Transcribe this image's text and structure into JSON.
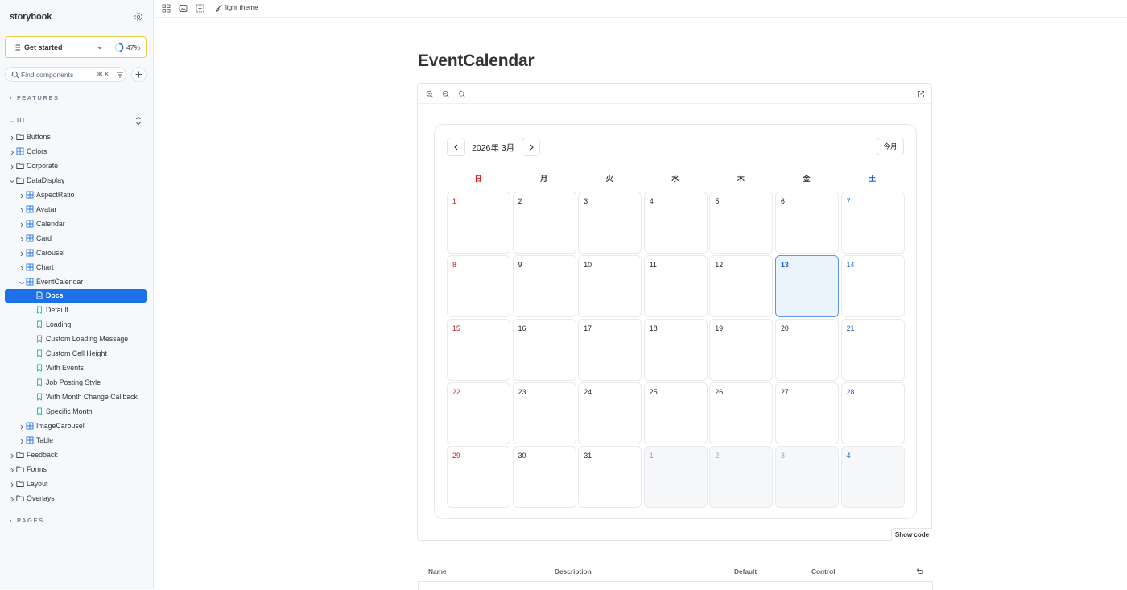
{
  "sidebar": {
    "brand": "storybook",
    "get_started": {
      "label": "Get started",
      "progress": "47%",
      "progress_fraction": 0.47
    },
    "search": {
      "placeholder": "Find components",
      "shortcut": "⌘ K"
    },
    "sections": {
      "features": "FEATURES",
      "ui": "UI",
      "pages": "PAGES"
    },
    "tree": [
      {
        "label": "Buttons",
        "type": "folder"
      },
      {
        "label": "Colors",
        "type": "component"
      },
      {
        "label": "Corporate",
        "type": "folder"
      },
      {
        "label": "DataDisplay",
        "type": "folder",
        "expanded": true
      },
      {
        "label": "AspectRatio",
        "type": "component"
      },
      {
        "label": "Avatar",
        "type": "component"
      },
      {
        "label": "Calendar",
        "type": "component"
      },
      {
        "label": "Card",
        "type": "component"
      },
      {
        "label": "Carousel",
        "type": "component"
      },
      {
        "label": "Chart",
        "type": "component"
      },
      {
        "label": "EventCalendar",
        "type": "component",
        "expanded": true
      },
      {
        "label": "Docs",
        "type": "docs",
        "selected": true
      },
      {
        "label": "Default",
        "type": "story"
      },
      {
        "label": "Loading",
        "type": "story"
      },
      {
        "label": "Custom Loading Message",
        "type": "story"
      },
      {
        "label": "Custom Cell Height",
        "type": "story"
      },
      {
        "label": "With Events",
        "type": "story"
      },
      {
        "label": "Job Posting Style",
        "type": "story"
      },
      {
        "label": "With Month Change Callback",
        "type": "story"
      },
      {
        "label": "Specific Month",
        "type": "story"
      },
      {
        "label": "ImageCarousel",
        "type": "component"
      },
      {
        "label": "Table",
        "type": "component"
      },
      {
        "label": "Feedback",
        "type": "folder"
      },
      {
        "label": "Forms",
        "type": "folder"
      },
      {
        "label": "Layout",
        "type": "folder"
      },
      {
        "label": "Overlays",
        "type": "folder"
      }
    ]
  },
  "toolbar": {
    "theme_label": "light theme"
  },
  "doc": {
    "title": "EventCalendar",
    "show_code": "Show code"
  },
  "calendar": {
    "month_label": "2026年 3月",
    "today_label": "今月",
    "weekdays": [
      "日",
      "月",
      "火",
      "水",
      "木",
      "金",
      "土"
    ],
    "weeks": [
      [
        {
          "d": "1"
        },
        {
          "d": "2"
        },
        {
          "d": "3"
        },
        {
          "d": "4"
        },
        {
          "d": "5"
        },
        {
          "d": "6"
        },
        {
          "d": "7"
        }
      ],
      [
        {
          "d": "8"
        },
        {
          "d": "9"
        },
        {
          "d": "10"
        },
        {
          "d": "11"
        },
        {
          "d": "12"
        },
        {
          "d": "13",
          "today": true
        },
        {
          "d": "14"
        }
      ],
      [
        {
          "d": "15"
        },
        {
          "d": "16"
        },
        {
          "d": "17"
        },
        {
          "d": "18"
        },
        {
          "d": "19"
        },
        {
          "d": "20"
        },
        {
          "d": "21"
        }
      ],
      [
        {
          "d": "22"
        },
        {
          "d": "23"
        },
        {
          "d": "24"
        },
        {
          "d": "25"
        },
        {
          "d": "26"
        },
        {
          "d": "27"
        },
        {
          "d": "28"
        }
      ],
      [
        {
          "d": "29"
        },
        {
          "d": "30"
        },
        {
          "d": "31"
        },
        {
          "d": "1",
          "other": true
        },
        {
          "d": "2",
          "other": true
        },
        {
          "d": "3",
          "other": true
        },
        {
          "d": "4",
          "other": true
        }
      ]
    ]
  },
  "args_table": {
    "headers": [
      "Name",
      "Description",
      "Default",
      "Control"
    ]
  },
  "colors": {
    "accent": "#1d71e8",
    "sunday": "#c81f1f",
    "saturday": "#1d5fd8",
    "today_bg": "#ebf3fd"
  }
}
